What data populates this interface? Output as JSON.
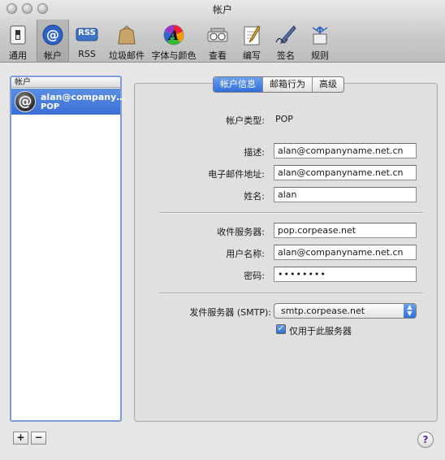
{
  "window": {
    "title": "帐户"
  },
  "toolbar": {
    "items": [
      {
        "label": "通用",
        "icon": "switch-icon"
      },
      {
        "label": "帐户",
        "icon": "at-icon"
      },
      {
        "label": "RSS",
        "icon": "rss-icon"
      },
      {
        "label": "垃圾邮件",
        "icon": "junk-bag-icon"
      },
      {
        "label": "字体与颜色",
        "icon": "font-color-icon"
      },
      {
        "label": "查看",
        "icon": "view-icon"
      },
      {
        "label": "编写",
        "icon": "compose-icon"
      },
      {
        "label": "签名",
        "icon": "signature-icon"
      },
      {
        "label": "规则",
        "icon": "rules-icon"
      }
    ],
    "rss_badge": "RSS"
  },
  "accounts": {
    "header": "帐户",
    "items": [
      {
        "name": "alan@company…",
        "type": "POP"
      }
    ],
    "add_label": "+",
    "remove_label": "−"
  },
  "tabs": [
    "帐户信息",
    "邮箱行为",
    "高级"
  ],
  "form": {
    "account_type_label": "帐户类型:",
    "account_type_value": "POP",
    "description_label": "描述:",
    "description_value": "alan@companyname.net.cn",
    "email_label": "电子邮件地址:",
    "email_value": "alan@companyname.net.cn",
    "fullname_label": "姓名:",
    "fullname_value": "alan",
    "incoming_label": "收件服务器:",
    "incoming_value": "pop.corpease.net",
    "username_label": "用户名称:",
    "username_value": "alan@companyname.net.cn",
    "password_label": "密码:",
    "password_value": "••••••••",
    "smtp_label": "发件服务器 (SMTP):",
    "smtp_value": "smtp.corpease.net",
    "only_server_label": "仅用于此服务器",
    "only_server_checked": true
  },
  "help_label": "?"
}
